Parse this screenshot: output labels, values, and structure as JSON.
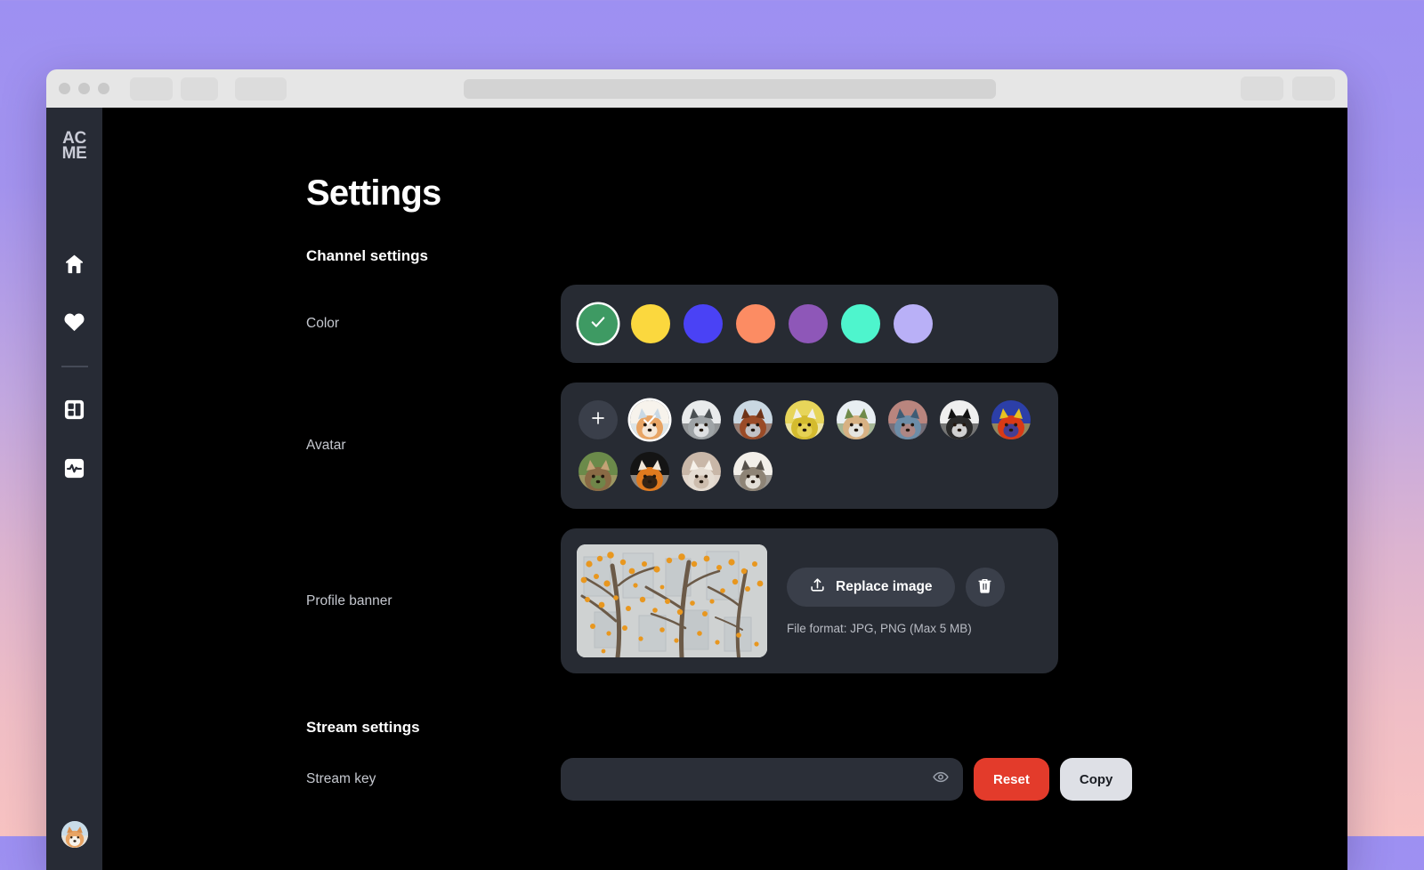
{
  "brand": {
    "line1": "AC",
    "line2": "ME"
  },
  "browser": {
    "traffic_lights": [
      "close",
      "minimize",
      "maximize"
    ],
    "tabs": [
      "tab-1",
      "tab-2",
      "tab-3"
    ],
    "url_placeholder": "",
    "right_buttons": [
      "action-1",
      "action-2"
    ]
  },
  "sidebar": {
    "items": [
      {
        "name": "home",
        "icon": "home-icon"
      },
      {
        "name": "favorites",
        "icon": "heart-icon"
      },
      {
        "name": "dashboard",
        "icon": "layout-grid-icon"
      },
      {
        "name": "analytics",
        "icon": "activity-pulse-icon"
      }
    ],
    "avatar_icon": "user-avatar-shiba"
  },
  "page": {
    "title": "Settings",
    "sections": [
      {
        "id": "channel",
        "title": "Channel settings"
      },
      {
        "id": "stream",
        "title": "Stream settings"
      }
    ]
  },
  "color_setting": {
    "label": "Color",
    "selected_index": 0,
    "check_icon": "check-icon",
    "swatches": [
      {
        "name": "green",
        "hex": "#3E9A63"
      },
      {
        "name": "yellow",
        "hex": "#FBD83E"
      },
      {
        "name": "blue",
        "hex": "#4A42F5"
      },
      {
        "name": "coral",
        "hex": "#FC8C63"
      },
      {
        "name": "purple",
        "hex": "#8E57B8"
      },
      {
        "name": "turquoise",
        "hex": "#4EF5CD"
      },
      {
        "name": "lavender",
        "hex": "#B9B0F7"
      }
    ]
  },
  "avatar_setting": {
    "label": "Avatar",
    "add_label": "+",
    "add_icon": "plus-icon",
    "check_icon": "check-icon",
    "selected_index": 0,
    "avatars": [
      {
        "name": "shiba-inu",
        "c1": "#E8A464",
        "c2": "#F7F3EC",
        "c3": "#C8D8E4"
      },
      {
        "name": "dog",
        "c1": "#9EA3A6",
        "c2": "#E9EBEC",
        "c3": "#4A4F52"
      },
      {
        "name": "horse",
        "c1": "#9A4B27",
        "c2": "#C9D7E2",
        "c3": "#6E3318"
      },
      {
        "name": "gazelle",
        "c1": "#D4BB2E",
        "c2": "#E7D55A",
        "c3": "#F2F0E6"
      },
      {
        "name": "giraffe",
        "c1": "#D7B183",
        "c2": "#E8EEF2",
        "c3": "#6F8A4A"
      },
      {
        "name": "hippo",
        "c1": "#6C8DA8",
        "c2": "#B9857E",
        "c3": "#3E5C75"
      },
      {
        "name": "pug",
        "c1": "#2A2A2A",
        "c2": "#EFEFEF",
        "c3": "#111111"
      },
      {
        "name": "parrot",
        "c1": "#D93A16",
        "c2": "#2C3FA8",
        "c3": "#E8C220"
      },
      {
        "name": "bear",
        "c1": "#8A6A45",
        "c2": "#6B8A4A",
        "c3": "#C4A276"
      },
      {
        "name": "tiger",
        "c1": "#E07A1E",
        "c2": "#141414",
        "c3": "#F0E6D8"
      },
      {
        "name": "sheep",
        "c1": "#E5DCD2",
        "c2": "#C9B7A8",
        "c3": "#F6F1EA"
      },
      {
        "name": "hedgehog",
        "c1": "#8E8476",
        "c2": "#F2EFE9",
        "c3": "#55504A"
      }
    ]
  },
  "banner_setting": {
    "label": "Profile banner",
    "thumbnail_name": "autumn-tree-building-photo",
    "replace_label": "Replace image",
    "replace_icon": "upload-icon",
    "delete_icon": "trash-icon",
    "format_hint": "File format: JPG, PNG (Max 5 MB)"
  },
  "stream_setting": {
    "label": "Stream key",
    "input_value": "",
    "input_icon": "eye-icon",
    "danger_label": "Reset",
    "light_label": "Copy"
  },
  "colors": {
    "page_bg": "#000000",
    "card_bg": "#272B33",
    "sidebar_bg": "#272B35",
    "control_bg": "#3A3F4A",
    "text_primary": "#FFFFFF",
    "text_muted": "#C5C8CF",
    "danger": "#E33B2B"
  }
}
